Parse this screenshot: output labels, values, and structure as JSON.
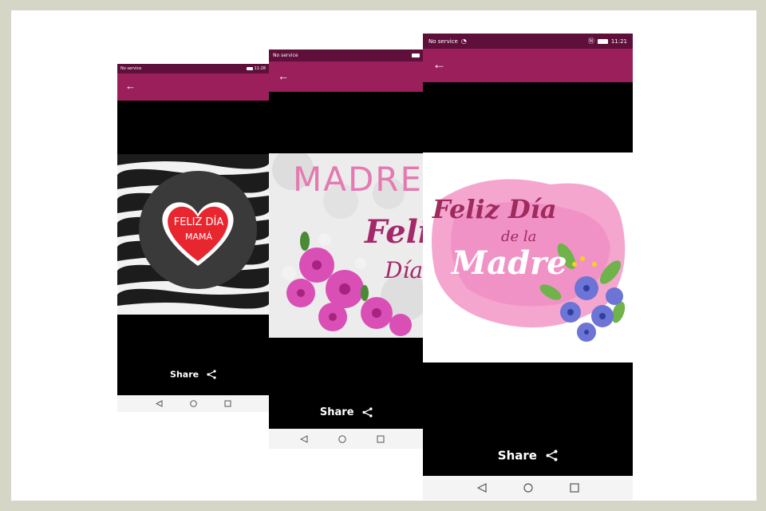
{
  "status": {
    "no_service": "No service",
    "time_left": "11:28",
    "time_right": "11:21"
  },
  "share_label": "Share",
  "cards": {
    "left": {
      "line1": "FELIZ DÍA",
      "line2": "MAMÁ"
    },
    "middle": {
      "line1": "MADRE",
      "line2": "Feli",
      "line3": "Día"
    },
    "right": {
      "line1": "Feliz Día",
      "line2": "de la",
      "line3": "Madre"
    }
  },
  "colors": {
    "status_bar": "#5e0f3a",
    "app_bar": "#9b1f5b",
    "heart": "#e8262f",
    "background": "#d6d6c6"
  },
  "icons": [
    "back-arrow-icon",
    "share-icon",
    "nav-back-icon",
    "nav-home-icon",
    "nav-recents-icon",
    "nfc-icon",
    "battery-icon",
    "wifi-icon"
  ]
}
